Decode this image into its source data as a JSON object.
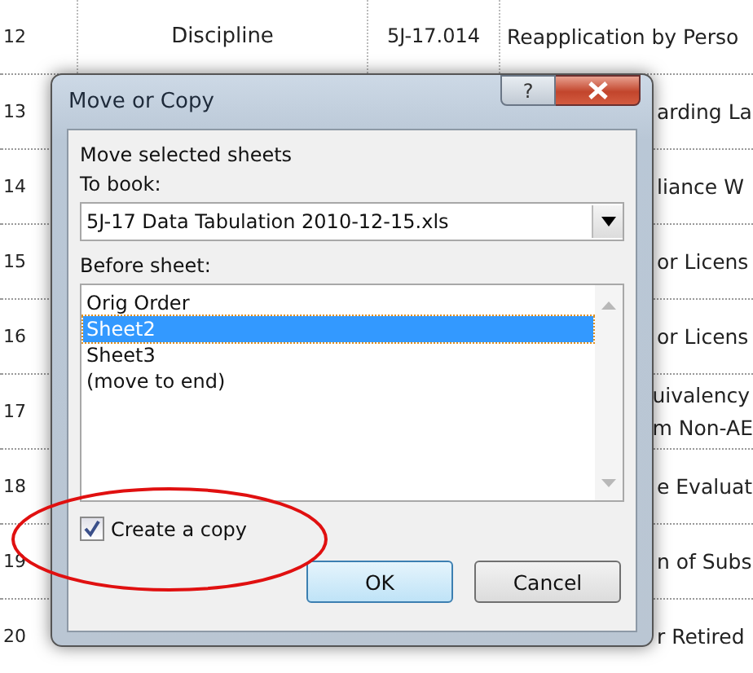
{
  "sheet": {
    "rows": [
      {
        "kind": "full",
        "number": "12",
        "cells": [
          "Discipline",
          "5J-17.014",
          "Reapplication by Perso"
        ]
      },
      {
        "kind": "partial",
        "number": "13",
        "cells": [
          "arding La"
        ]
      },
      {
        "kind": "partial",
        "number": "14",
        "cells": [
          "liance W"
        ]
      },
      {
        "kind": "partial",
        "number": "15",
        "cells": [
          "or Licens"
        ]
      },
      {
        "kind": "partial",
        "number": "16",
        "cells": [
          "or Licens"
        ]
      },
      {
        "kind": "partial",
        "number": "17",
        "cells": [
          "uivalency\nm Non-AE"
        ]
      },
      {
        "kind": "partial",
        "number": "18",
        "cells": [
          "e Evaluat"
        ]
      },
      {
        "kind": "partial",
        "number": "19",
        "cells": [
          "n of Subs"
        ]
      },
      {
        "kind": "partial",
        "number": "20",
        "cells": [
          "r Retired"
        ]
      }
    ]
  },
  "dialog": {
    "title": "Move or Copy",
    "help_button": "?",
    "heading": "Move selected sheets",
    "to_book_label": "To book:",
    "to_book_value": "5J-17 Data Tabulation 2010-12-15.xls",
    "before_sheet_label": "Before sheet:",
    "sheets": [
      {
        "label": "Orig Order",
        "selected": false
      },
      {
        "label": "Sheet2",
        "selected": true
      },
      {
        "label": "Sheet3",
        "selected": false
      },
      {
        "label": "(move to end)",
        "selected": false
      }
    ],
    "create_copy": {
      "label": "Create a copy",
      "checked": true
    },
    "buttons": [
      {
        "label": "OK",
        "kind": "default"
      },
      {
        "label": "Cancel",
        "kind": "normal"
      }
    ]
  }
}
